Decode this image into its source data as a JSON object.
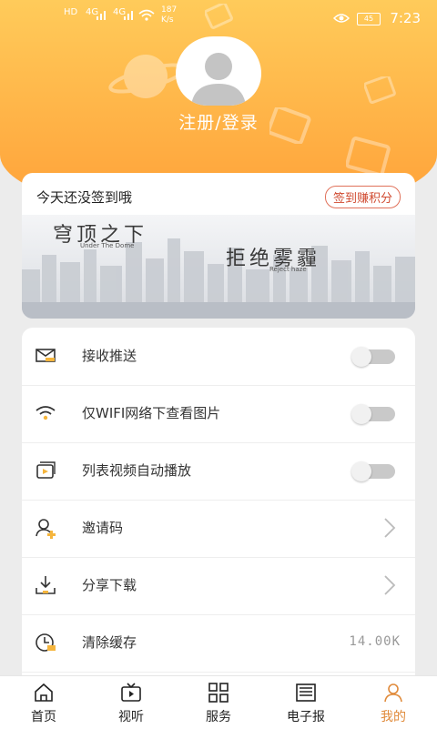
{
  "status_bar": {
    "network_1": "4G",
    "network_2": "4G",
    "speed_value": "187",
    "speed_unit": "K/s",
    "battery": "45",
    "time": "7:23"
  },
  "profile": {
    "login_text": "注册/登录"
  },
  "sign_card": {
    "prompt": "今天还没签到哦",
    "button": "签到赚积分",
    "banner_title_1": "穹顶之下",
    "banner_sub_1": "Under The Dome",
    "banner_title_2": "拒绝雾霾",
    "banner_sub_2": "Reject haze"
  },
  "settings": [
    {
      "label": "接收推送",
      "icon": "mail-icon",
      "control": "toggle",
      "on": false
    },
    {
      "label": "仅WIFI网络下查看图片",
      "icon": "wifi-icon",
      "control": "toggle",
      "on": false
    },
    {
      "label": "列表视频自动播放",
      "icon": "video-play-icon",
      "control": "toggle",
      "on": false
    },
    {
      "label": "邀请码",
      "icon": "add-user-icon",
      "control": "arrow"
    },
    {
      "label": "分享下载",
      "icon": "download-icon",
      "control": "arrow"
    },
    {
      "label": "清除缓存",
      "icon": "clear-cache-icon",
      "control": "value",
      "value": "14.00K"
    }
  ],
  "tabbar": {
    "items": [
      {
        "label": "首页",
        "icon": "home-icon"
      },
      {
        "label": "视听",
        "icon": "tv-icon"
      },
      {
        "label": "服务",
        "icon": "grid-icon"
      },
      {
        "label": "电子报",
        "icon": "newspaper-icon"
      },
      {
        "label": "我的",
        "icon": "person-icon",
        "active": true
      }
    ]
  },
  "colors": {
    "header_top": "#ffcb5a",
    "header_bottom": "#ff9f37",
    "accent": "#e08a3a",
    "sign_button": "#d04a30"
  }
}
